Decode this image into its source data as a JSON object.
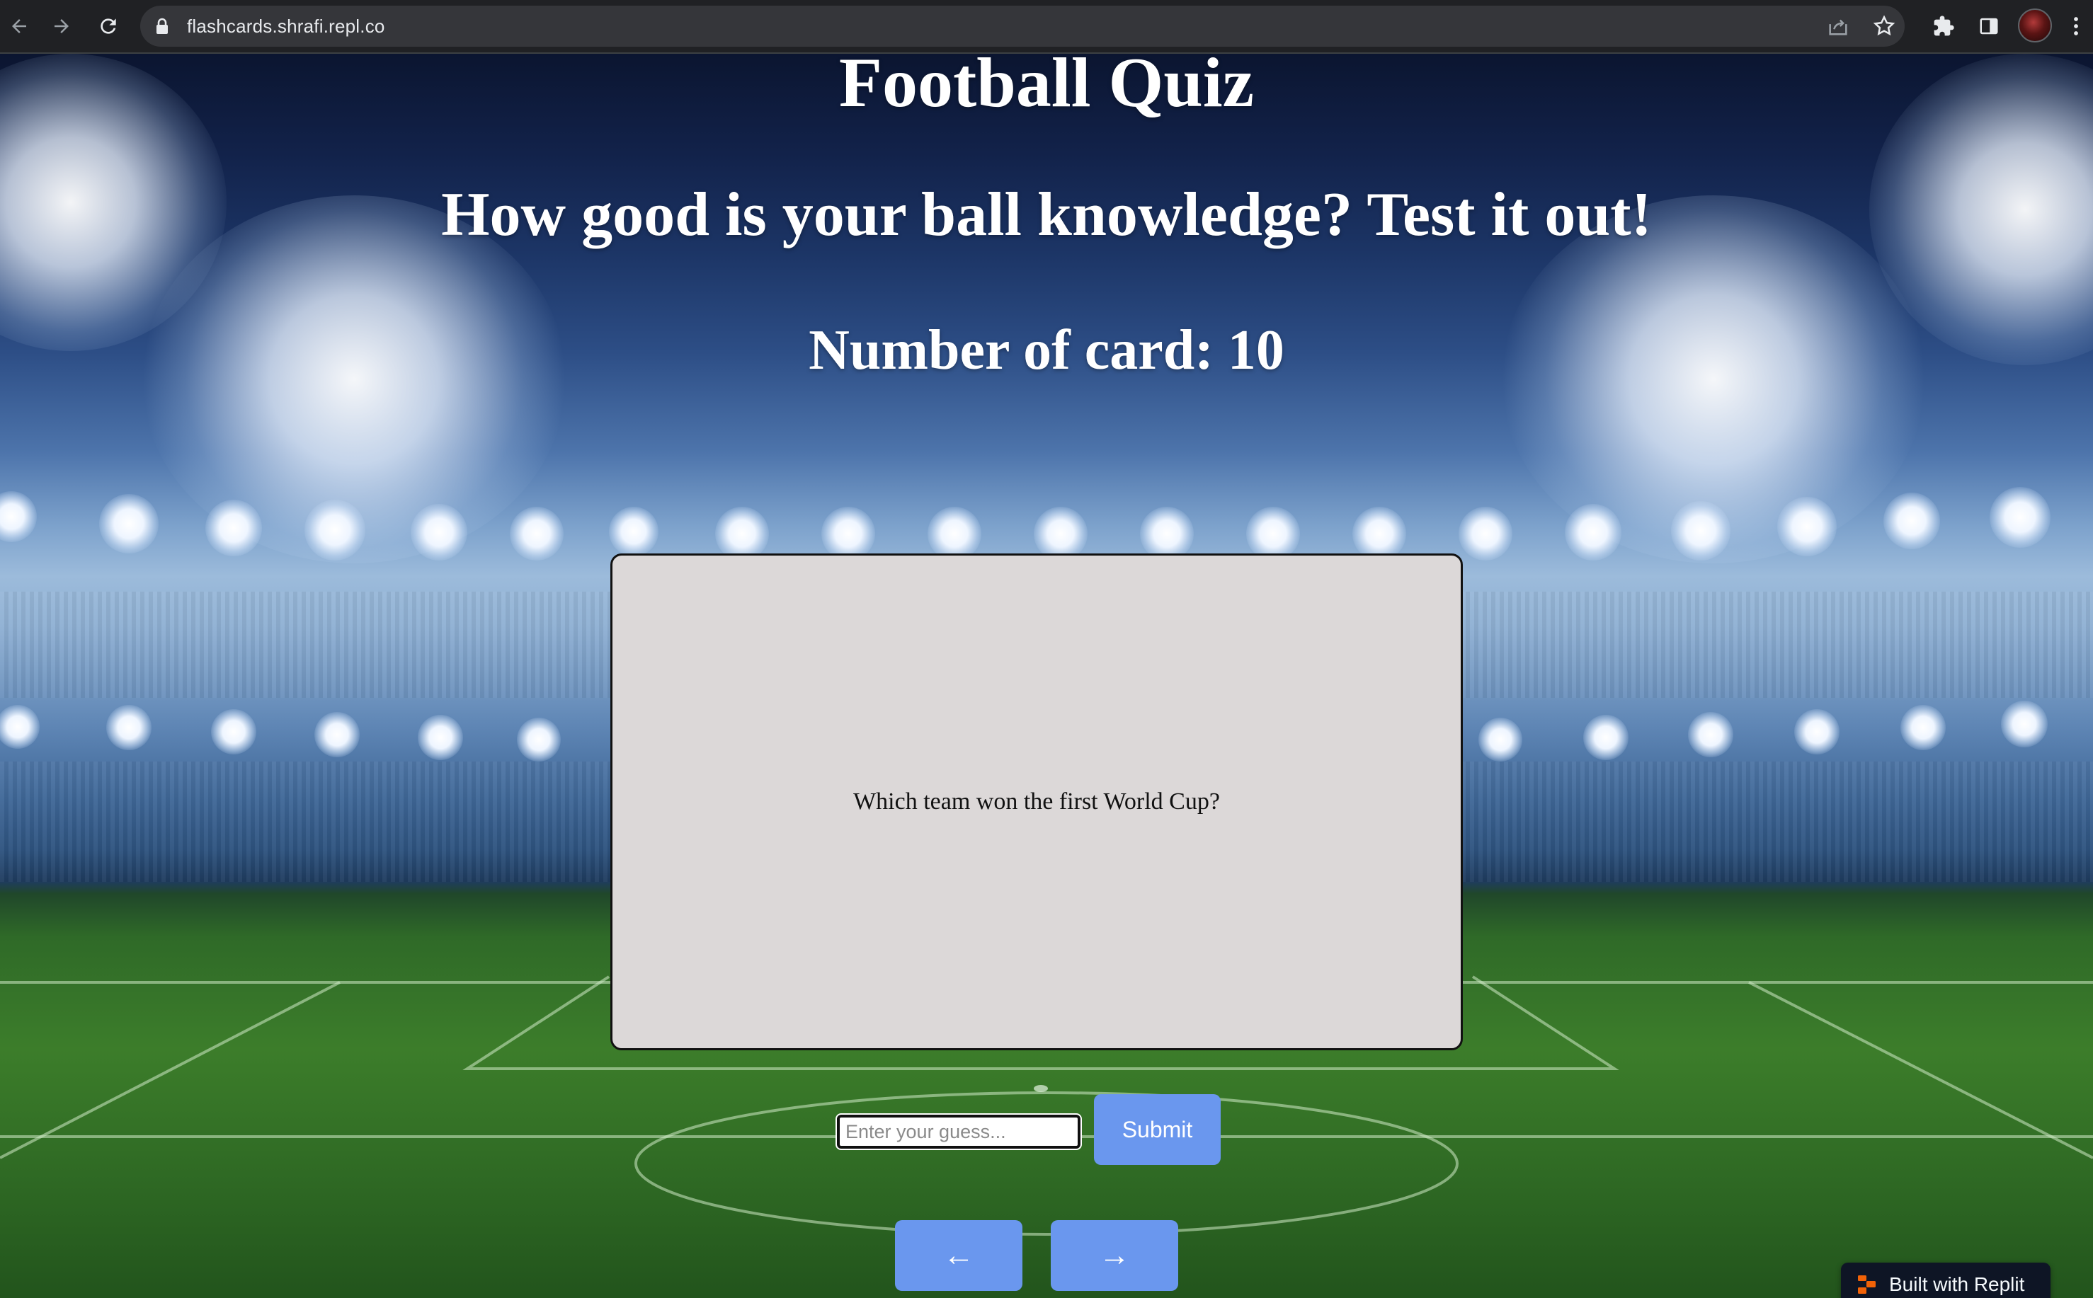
{
  "browser": {
    "url": "flashcards.shrafi.repl.co",
    "icons": [
      "back-arrow-icon",
      "forward-arrow-icon",
      "reload-icon",
      "lock-icon",
      "share-icon",
      "star-icon",
      "extensions-icon",
      "side-panel-icon",
      "profile-avatar",
      "more-menu-icon"
    ]
  },
  "header": {
    "title": "Football Quiz",
    "subtitle": "How good is your ball knowledge? Test it out!",
    "card_count": "Number of card: 10"
  },
  "card": {
    "question": "Which team won the first World Cup?"
  },
  "guess": {
    "placeholder": "Enter your guess...",
    "value": "",
    "submit_label": "Submit"
  },
  "navigation": {
    "prev_label": "←",
    "next_label": "→"
  },
  "badge": {
    "label": "Built with Replit",
    "icon": "replit-logo-icon"
  },
  "colors": {
    "button": "#6a97ee",
    "card": "#dcd8d8",
    "badge_bg": "#0e1525",
    "replit_orange": "#f26207"
  }
}
